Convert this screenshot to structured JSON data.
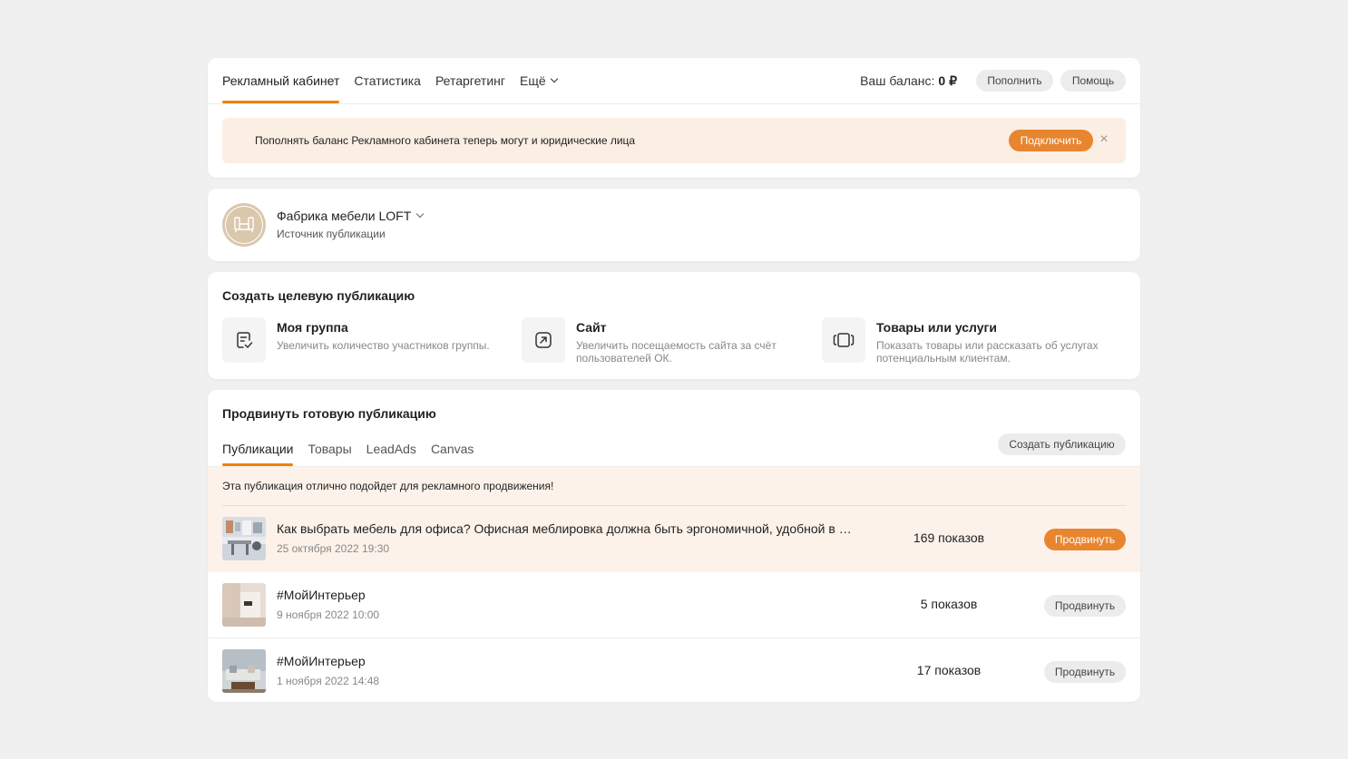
{
  "nav": {
    "tabs": [
      {
        "label": "Рекламный кабинет",
        "active": true
      },
      {
        "label": "Статистика"
      },
      {
        "label": "Ретаргетинг"
      },
      {
        "label": "Ещё"
      }
    ],
    "balance_label": "Ваш баланс:",
    "balance_value": "0 ₽",
    "topup_label": "Пополнить",
    "help_label": "Помощь"
  },
  "banner": {
    "text": "Пополнять баланс Рекламного кабинета теперь могут и юридические лица",
    "button_label": "Подключить",
    "close_icon": "×"
  },
  "group": {
    "name": "Фабрика мебели LOFT",
    "subtitle": "Источник публикации",
    "avatar_icon": "furniture-icon"
  },
  "create": {
    "title": "Создать целевую публикацию",
    "options": [
      {
        "title": "Моя группа",
        "desc": "Увеличить количество участников группы.",
        "icon": "group-post-icon"
      },
      {
        "title": "Сайт",
        "desc": "Увеличить посещаемость сайта за счёт пользователей ОК.",
        "icon": "external-link-icon"
      },
      {
        "title": "Товары или услуги",
        "desc": "Показать товары или рассказать об услугах потенциальным клиентам.",
        "icon": "carousel-icon"
      }
    ]
  },
  "promote": {
    "title": "Продвинуть готовую публикацию",
    "tabs": [
      {
        "label": "Публикации",
        "active": true
      },
      {
        "label": "Товары"
      },
      {
        "label": "LeadAds"
      },
      {
        "label": "Canvas"
      }
    ],
    "create_button_label": "Создать публикацию",
    "hint": "Эта публикация отлично подойдет для рекламного продвижения!",
    "rows": [
      {
        "title": "Как выбрать мебель для офиса? Офисная меблировка должна быть эргономичной, удобной в …",
        "date": "25 октября 2022 19:30",
        "views": "169 показов",
        "button_label": "Продвинуть",
        "highlighted": true
      },
      {
        "title": "#МойИнтерьер",
        "date": "9 ноября 2022 10:00",
        "views": "5 показов",
        "button_label": "Продвинуть"
      },
      {
        "title": "#МойИнтерьер",
        "date": "1 ноября 2022 14:48",
        "views": "17 показов",
        "button_label": "Продвинуть"
      }
    ]
  },
  "colors": {
    "accent": "#e8852f",
    "tab_underline": "#ee8208",
    "banner_bg": "#fbeee3",
    "highlight_bg": "#fdf2ea",
    "page_bg": "#f0f0f0"
  }
}
